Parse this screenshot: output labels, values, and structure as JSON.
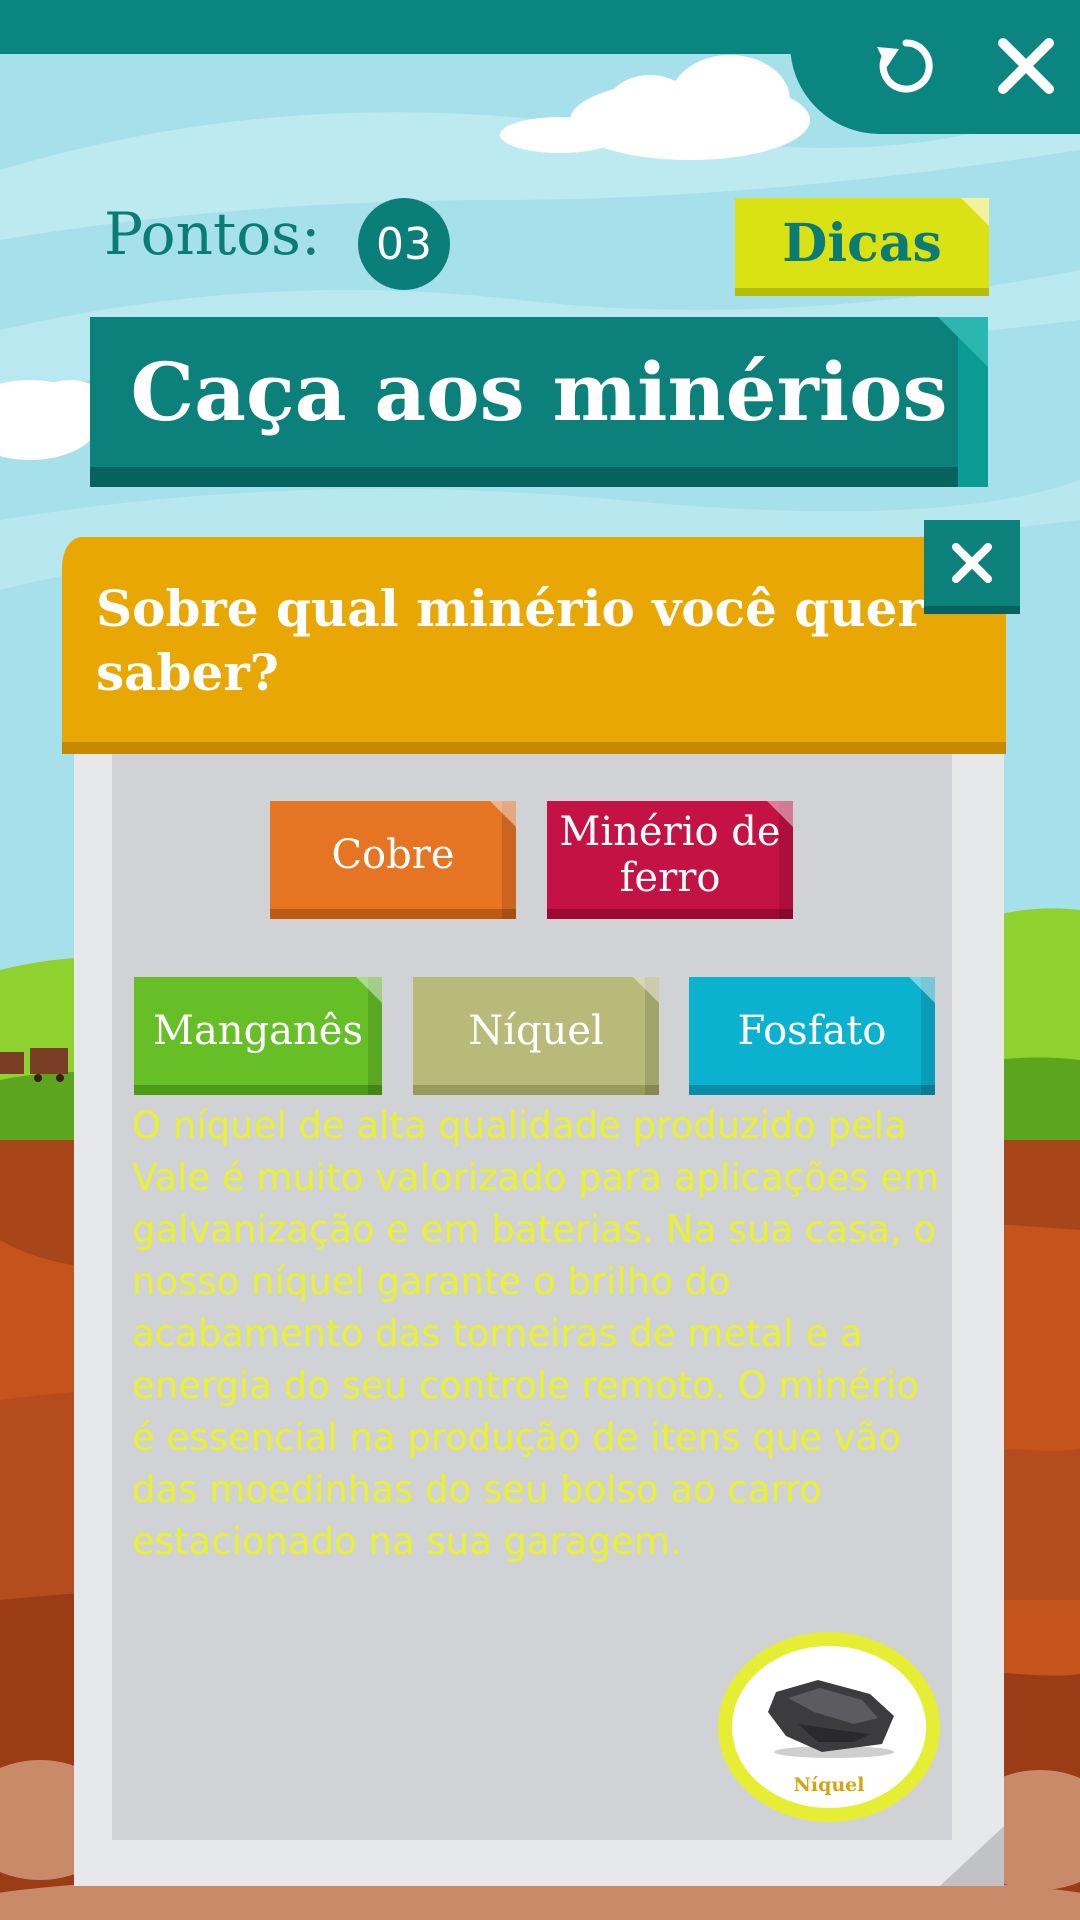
{
  "header": {
    "reload_icon": "reload-icon",
    "close_icon": "close-icon"
  },
  "score": {
    "label": "Pontos:",
    "value": "03"
  },
  "hints": {
    "label": "Dicas"
  },
  "title": "Caça aos minérios",
  "panel": {
    "question": "Sobre qual minério você quer saber?",
    "close_icon": "close-icon",
    "options": [
      {
        "label": "Cobre",
        "color": "#e57423"
      },
      {
        "label": "Minério de ferro",
        "color": "#c51244"
      },
      {
        "label": "Manganês",
        "color": "#67bf28"
      },
      {
        "label": "Níquel",
        "color": "#b9b97a"
      },
      {
        "label": "Fosfato",
        "color": "#0bb2d0"
      }
    ],
    "description": "O níquel de alta qualidade produzido pela Vale é muito valorizado para aplicações em galvanização e em baterias. Na sua casa, o nosso níquel garante o brilho do acabamento das torneiras de metal e a energia do seu controle remoto. O minério é essencial na produção de itens que vão das moedinhas do seu bolso ao carro estacionado na sua garagem.",
    "medal_label": "Níquel"
  },
  "colors": {
    "teal": "#0a8580",
    "panel_orange": "#e9a703",
    "description_text": "#e8f22f",
    "hints_yellow": "#dbe213"
  }
}
